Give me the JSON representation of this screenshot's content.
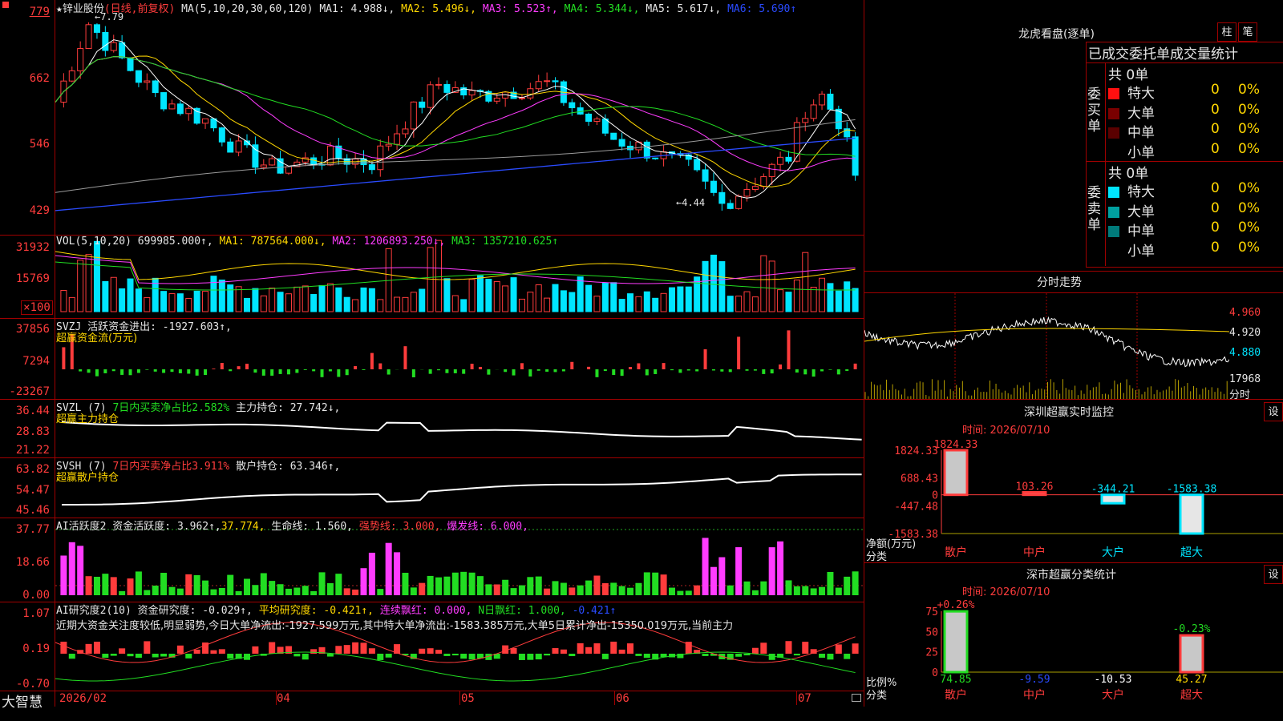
{
  "colors": {
    "up": "#ff3c3c",
    "down": "#00e5ff",
    "frame": "#a00000",
    "ma1": "#ffffff",
    "ma2": "#ffd700",
    "ma3": "#ff3cff",
    "ma4": "#22dd22",
    "ma5": "#9a9a9a",
    "ma6": "#2a4bff",
    "green_bar": "#22dd22"
  },
  "main": {
    "pin_icon": "pin-icon",
    "title": "★锌业股份",
    "mode": "(日线,前复权)",
    "ma_label": "MA(5,10,20,30,60,120)",
    "ma1": "MA1: 4.988↓,",
    "ma2": "MA2: 5.496↓,",
    "ma3": "MA3: 5.523↑,",
    "ma4": "MA4: 5.344↓,",
    "ma5": "MA5: 5.617↓,",
    "ma6": "MA6: 5.690↑",
    "y_labels": [
      "779",
      "662",
      "546",
      "429"
    ],
    "high_note": "←7.79",
    "low_note": "←4.44"
  },
  "vol": {
    "label": "VOL(5,10,20)",
    "value": "699985.000↑,",
    "ma1": "MA1: 787564.000↓,",
    "ma2": "MA2: 1206893.250↓,",
    "ma3": "MA3: 1357210.625↑",
    "y_labels": [
      "31932",
      "15769",
      "×100"
    ]
  },
  "svzj": {
    "label": "SVZJ  活跃资金进出: -1927.603↑,",
    "sub": "超赢资金流(万元)",
    "y_labels": [
      "37856",
      "7294",
      "-23267"
    ]
  },
  "svzl": {
    "label": "SVZL (7)",
    "desc": "7日内买卖净占比2.582%",
    "hold": "主力持仓: 27.742↓,",
    "sub": "超赢主力持仓",
    "y_labels": [
      "36.44",
      "28.83",
      "21.22"
    ]
  },
  "svsh": {
    "label": "SVSH (7)",
    "desc": "7日内买卖净占比3.911%",
    "hold": "散户持仓: 63.346↑,",
    "sub": "超赢散户持仓",
    "y_labels": [
      "63.82",
      "54.47",
      "45.46"
    ]
  },
  "ai1": {
    "label": "AI活跃度2 资金活跃度: 3.962↑,",
    "v2": "37.774,",
    "life": "生命线: 1.560,",
    "strong": "强势线: 3.000,",
    "burst": "爆发线: 6.000,",
    "y_labels": [
      "37.77",
      "18.66",
      "0.00"
    ]
  },
  "ai2": {
    "label": "AI研究度2(10) 资金研究度: -0.029↑,",
    "avg": "平均研究度: -0.421↑,",
    "cont": "连续飘红: 0.000,",
    "nday": "N日飘红: 1.000,",
    "neg": "-0.421↑",
    "comment": "近期大资金关注度较低,明显弱势,今日大单净流出:-1927.599万元,其中特大单净流出:-1583.385万元,大单5日累计净出-15350.019万元,当前主力",
    "y_labels": [
      "1.07",
      "0.19",
      "-0.70"
    ]
  },
  "xaxis": {
    "labels": [
      "2026/02",
      "04",
      "05",
      "06",
      "07"
    ],
    "brand": "大智慧"
  },
  "rp": {
    "dragon_title": "龙虎看盘(逐单)",
    "btn_zhu": "柱",
    "btn_bi": "笔",
    "stat_title": "已成交委托单成交量统计",
    "buy_side": "委买单",
    "sell_side": "委卖单",
    "buy_total": "共 0单",
    "sell_total": "共 0单",
    "buy_rows": [
      {
        "name": "特大",
        "vol": "0",
        "pct": "0%",
        "color": "#ff1010"
      },
      {
        "name": "大单",
        "vol": "0",
        "pct": "0%",
        "color": "#7a0000"
      },
      {
        "name": "中单",
        "vol": "0",
        "pct": "0%",
        "color": "#5a0000"
      },
      {
        "name": "小单",
        "vol": "0",
        "pct": "0%",
        "color": "#000000"
      }
    ],
    "sell_rows": [
      {
        "name": "特大",
        "vol": "0",
        "pct": "0%",
        "color": "#00e5ff"
      },
      {
        "name": "大单",
        "vol": "0",
        "pct": "0%",
        "color": "#00a0a0"
      },
      {
        "name": "中单",
        "vol": "0",
        "pct": "0%",
        "color": "#007a7a"
      },
      {
        "name": "小单",
        "vol": "0",
        "pct": "0%",
        "color": "#000000"
      }
    ],
    "intraday_title": "分时走势",
    "intraday_y": [
      "4.960",
      "4.920",
      "4.880"
    ],
    "intraday_vol": "17968",
    "intraday_unit": "分时",
    "monitor_title": "深圳超赢实时监控",
    "monitor_set": "设",
    "monitor_time": "时间: 2026/07/10",
    "monitor_y": [
      "1824.33",
      "688.43",
      "0",
      "-447.48",
      "-1583.38"
    ],
    "monitor_unit": "净额(万元)",
    "monitor_cat": "分类",
    "monitor_values": [
      {
        "cat": "散户",
        "value": 1824.33,
        "label": "1824.33"
      },
      {
        "cat": "中户",
        "value": 103.26,
        "label": "103.26"
      },
      {
        "cat": "大户",
        "value": -344.21,
        "label": "-344.21"
      },
      {
        "cat": "超大",
        "value": -1583.38,
        "label": "-1583.38"
      }
    ],
    "class_title": "深市超赢分类统计",
    "class_set": "设",
    "class_time": "时间: 2026/07/10",
    "class_y": [
      "75",
      "50",
      "25",
      "0"
    ],
    "class_unit": "比例%",
    "class_cat": "分类",
    "class_values": [
      {
        "cat": "散户",
        "value": 74.85,
        "label": "74.85",
        "change": "+0.26%"
      },
      {
        "cat": "中户",
        "value": 9.59,
        "label": "-9.59",
        "change": ""
      },
      {
        "cat": "大户",
        "value": 10.53,
        "label": "-10.53",
        "change": ""
      },
      {
        "cat": "超大",
        "value": 45.27,
        "label": "45.27",
        "change": "-0.23%"
      }
    ]
  }
}
